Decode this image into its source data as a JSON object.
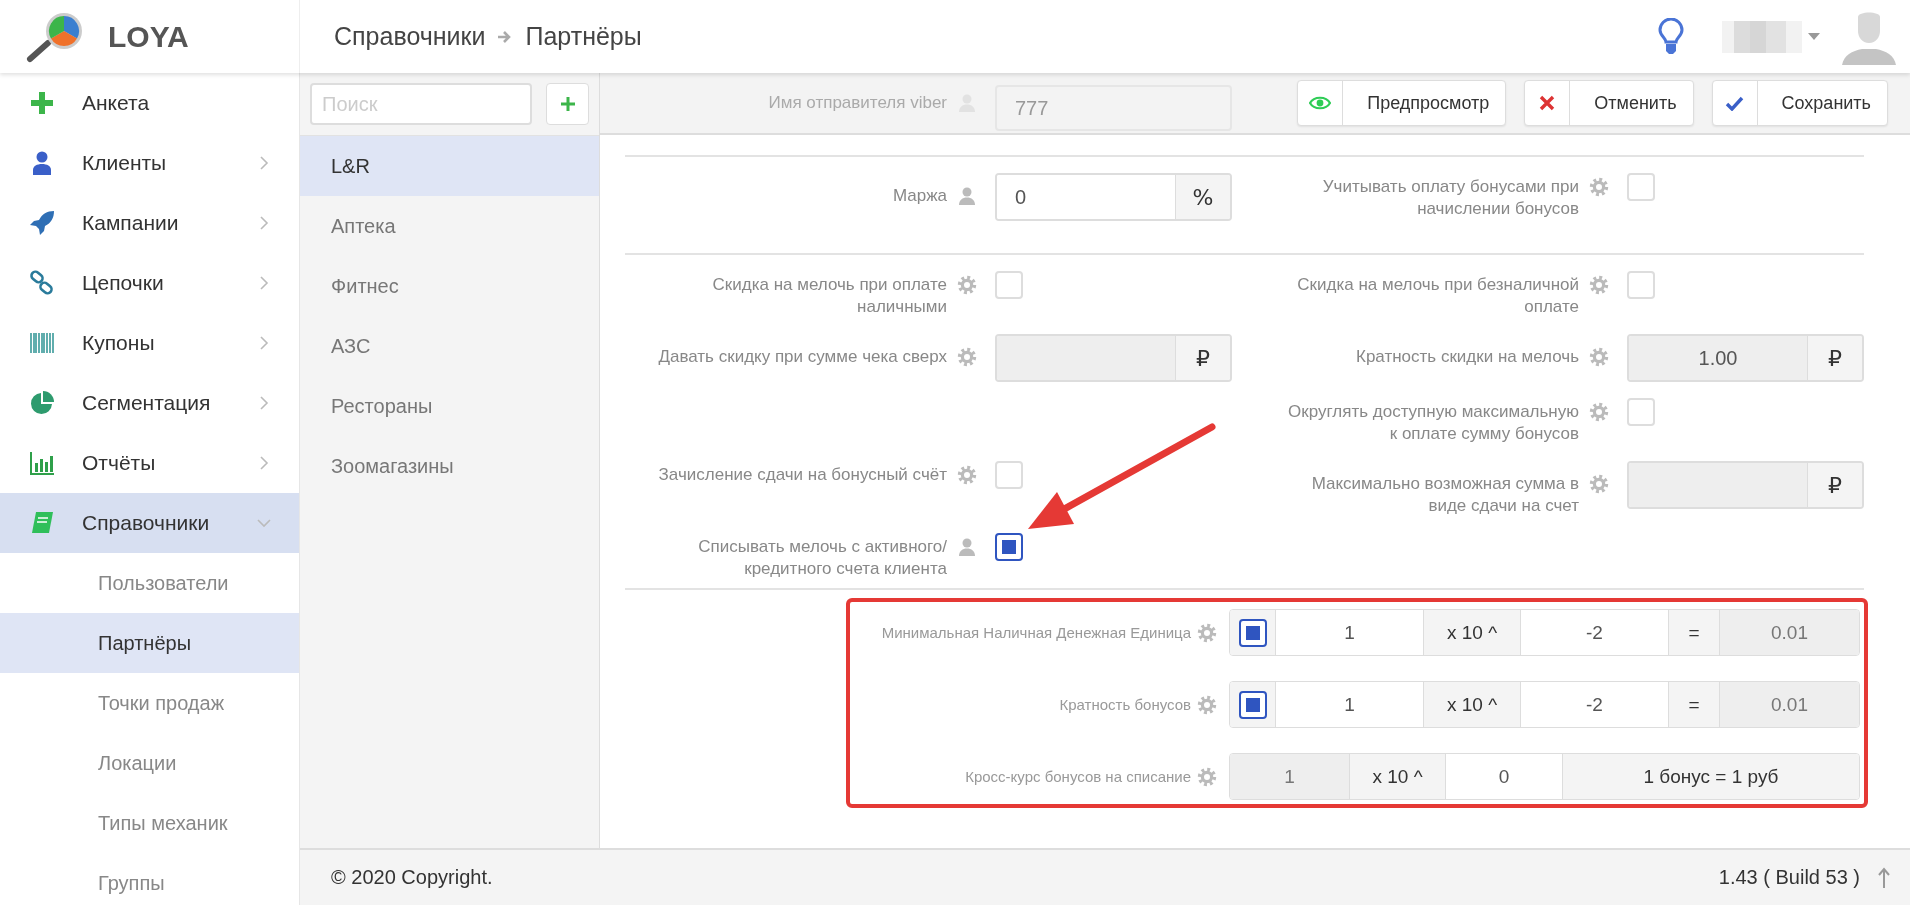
{
  "header": {
    "logo": "LOYA",
    "breadcrumb": [
      "Справочники",
      "Партнёры"
    ]
  },
  "sidebar": {
    "items": [
      {
        "label": "Анкета",
        "kind": "plus",
        "expandable": false,
        "selected": false
      },
      {
        "label": "Клиенты",
        "kind": "user",
        "expandable": true,
        "expanded": false,
        "selected": false
      },
      {
        "label": "Кампании",
        "kind": "rocket",
        "expandable": true,
        "expanded": false,
        "selected": false
      },
      {
        "label": "Цепочки",
        "kind": "chain",
        "expandable": true,
        "expanded": false,
        "selected": false
      },
      {
        "label": "Купоны",
        "kind": "barcode",
        "expandable": true,
        "expanded": false,
        "selected": false
      },
      {
        "label": "Сегментация",
        "kind": "pie",
        "expandable": true,
        "expanded": false,
        "selected": false
      },
      {
        "label": "Отчёты",
        "kind": "chart",
        "expandable": true,
        "expanded": false,
        "selected": false
      },
      {
        "label": "Справочники",
        "kind": "book",
        "expandable": true,
        "expanded": true,
        "selected": true,
        "children": [
          {
            "label": "Пользователи",
            "selected": false
          },
          {
            "label": "Партнёры",
            "selected": true
          },
          {
            "label": "Точки продаж",
            "selected": false
          },
          {
            "label": "Локации",
            "selected": false
          },
          {
            "label": "Типы механик",
            "selected": false
          },
          {
            "label": "Группы",
            "selected": false
          }
        ]
      }
    ]
  },
  "partners": {
    "search": {
      "placeholder": "Поиск"
    },
    "items": [
      {
        "label": "L&R",
        "selected": true
      },
      {
        "label": "Аптека",
        "selected": false
      },
      {
        "label": "Фитнес",
        "selected": false
      },
      {
        "label": "АЗС",
        "selected": false
      },
      {
        "label": "Рестораны",
        "selected": false
      },
      {
        "label": "Зоомагазины",
        "selected": false
      }
    ]
  },
  "toolbar": {
    "behind": {
      "label": "Имя отправителя viber",
      "value": "777"
    },
    "buttons": [
      {
        "label": "Предпросмотр",
        "kind": "preview"
      },
      {
        "label": "Отменить",
        "kind": "cancel"
      },
      {
        "label": "Сохранить",
        "kind": "save"
      }
    ]
  },
  "sections": [
    {
      "rows": [
        {
          "left": {
            "label": "Маржа",
            "hint": {
              "kind": "user"
            },
            "kind": "input",
            "value": "0",
            "unit": "%",
            "disabled": false
          },
          "right": {
            "label": "Учитывать оплату бонусами при начислении бонусов",
            "hint": {
              "kind": "gear"
            },
            "kind": "checkbox",
            "checked": false
          }
        }
      ]
    },
    {
      "rows": [
        {
          "left": {
            "label": "Скидка на мелочь при оплате наличными",
            "hint": {
              "kind": "gear"
            },
            "kind": "checkbox",
            "checked": false
          },
          "right": {
            "label": "Скидка на мелочь при безналичной оплате",
            "hint": {
              "kind": "gear"
            },
            "kind": "checkbox",
            "checked": false
          }
        },
        {
          "left": {
            "label": "Давать скидку при сумме чека сверх",
            "hint": {
              "kind": "gear"
            },
            "kind": "input",
            "unit": "₽",
            "disabled": true
          },
          "right": {
            "label": "Кратность скидки на мелочь",
            "hint": {
              "kind": "gear"
            },
            "kind": "input",
            "value": "1.00",
            "unit": "₽",
            "disabled": true
          }
        },
        {
          "right": {
            "label": "Округлять доступную максимальную к оплате сумму бонусов",
            "hint": {
              "kind": "gear"
            },
            "kind": "checkbox",
            "checked": false
          }
        },
        {
          "left": {
            "label": "Зачисление сдачи на бонусный счёт",
            "hint": {
              "kind": "gear"
            },
            "kind": "checkbox",
            "checked": false
          },
          "right": {
            "label": "Максимально возможная сумма в виде сдачи на счет",
            "hint": {
              "kind": "gear"
            },
            "kind": "input",
            "unit": "₽",
            "disabled": true
          }
        },
        {
          "left": {
            "label": "Списывать мелочь с активного/кредитного счета клиента",
            "hint": {
              "kind": "user"
            },
            "kind": "checkbox",
            "checked": true
          }
        }
      ]
    }
  ],
  "units": {
    "highlighted": true,
    "rows": [
      {
        "label": "Минимальная Наличная Денежная Единица",
        "kind": "unit",
        "checked": true,
        "mantissa": "1",
        "times": "x 10 ^",
        "exponent": "-2",
        "equals": "=",
        "result": "0.01"
      },
      {
        "label": "Кратность бонусов",
        "kind": "unit",
        "checked": true,
        "mantissa": "1",
        "times": "x 10 ^",
        "exponent": "-2",
        "equals": "=",
        "result": "0.01"
      },
      {
        "label": "Кросс-курс бонусов на списание",
        "kind": "rate",
        "mantissa": "1",
        "times": "x 10 ^",
        "exponent": "0",
        "result": "1 бонус = 1 руб"
      }
    ]
  },
  "annotation_arrow": true,
  "footer": {
    "copyright": "© 2020 Copyright.",
    "version": "1.43 ( Build 53 )"
  }
}
